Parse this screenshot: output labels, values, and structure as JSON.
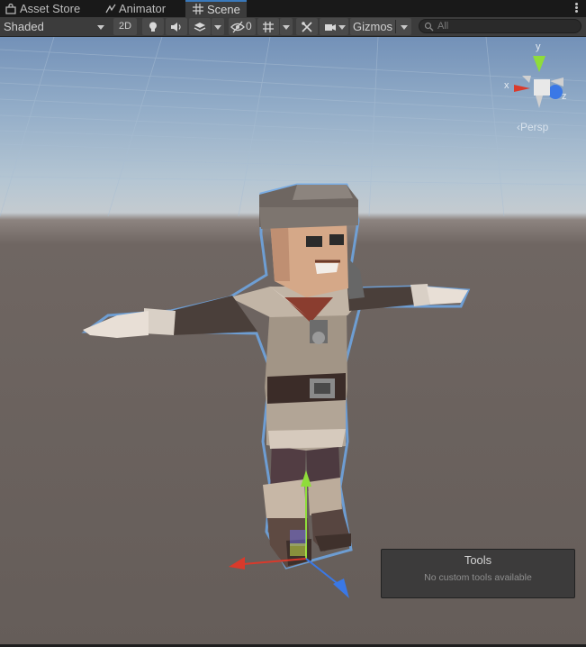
{
  "tabs": [
    {
      "label": "Asset Store",
      "icon": "asset-store-icon"
    },
    {
      "label": "Animator",
      "icon": "animator-icon"
    },
    {
      "label": "Scene",
      "icon": "scene-grid-icon",
      "active": true
    }
  ],
  "toolbar": {
    "shading_mode": "Shaded",
    "mode_2d": "2D",
    "hidden_count": "0",
    "gizmos_label": "Gizmos",
    "search_placeholder": "All"
  },
  "orientation_gizmo": {
    "y_label": "y",
    "x_label": "x",
    "z_label": "z",
    "projection": "Persp"
  },
  "overlay": {
    "title": "Tools",
    "message": "No custom tools available"
  },
  "colors": {
    "accent": "#3a79bb",
    "axis_x": "#d93a2b",
    "axis_y": "#8fdc3a",
    "axis_z": "#3a78e6",
    "selection_outline": "#6fa8e8"
  }
}
